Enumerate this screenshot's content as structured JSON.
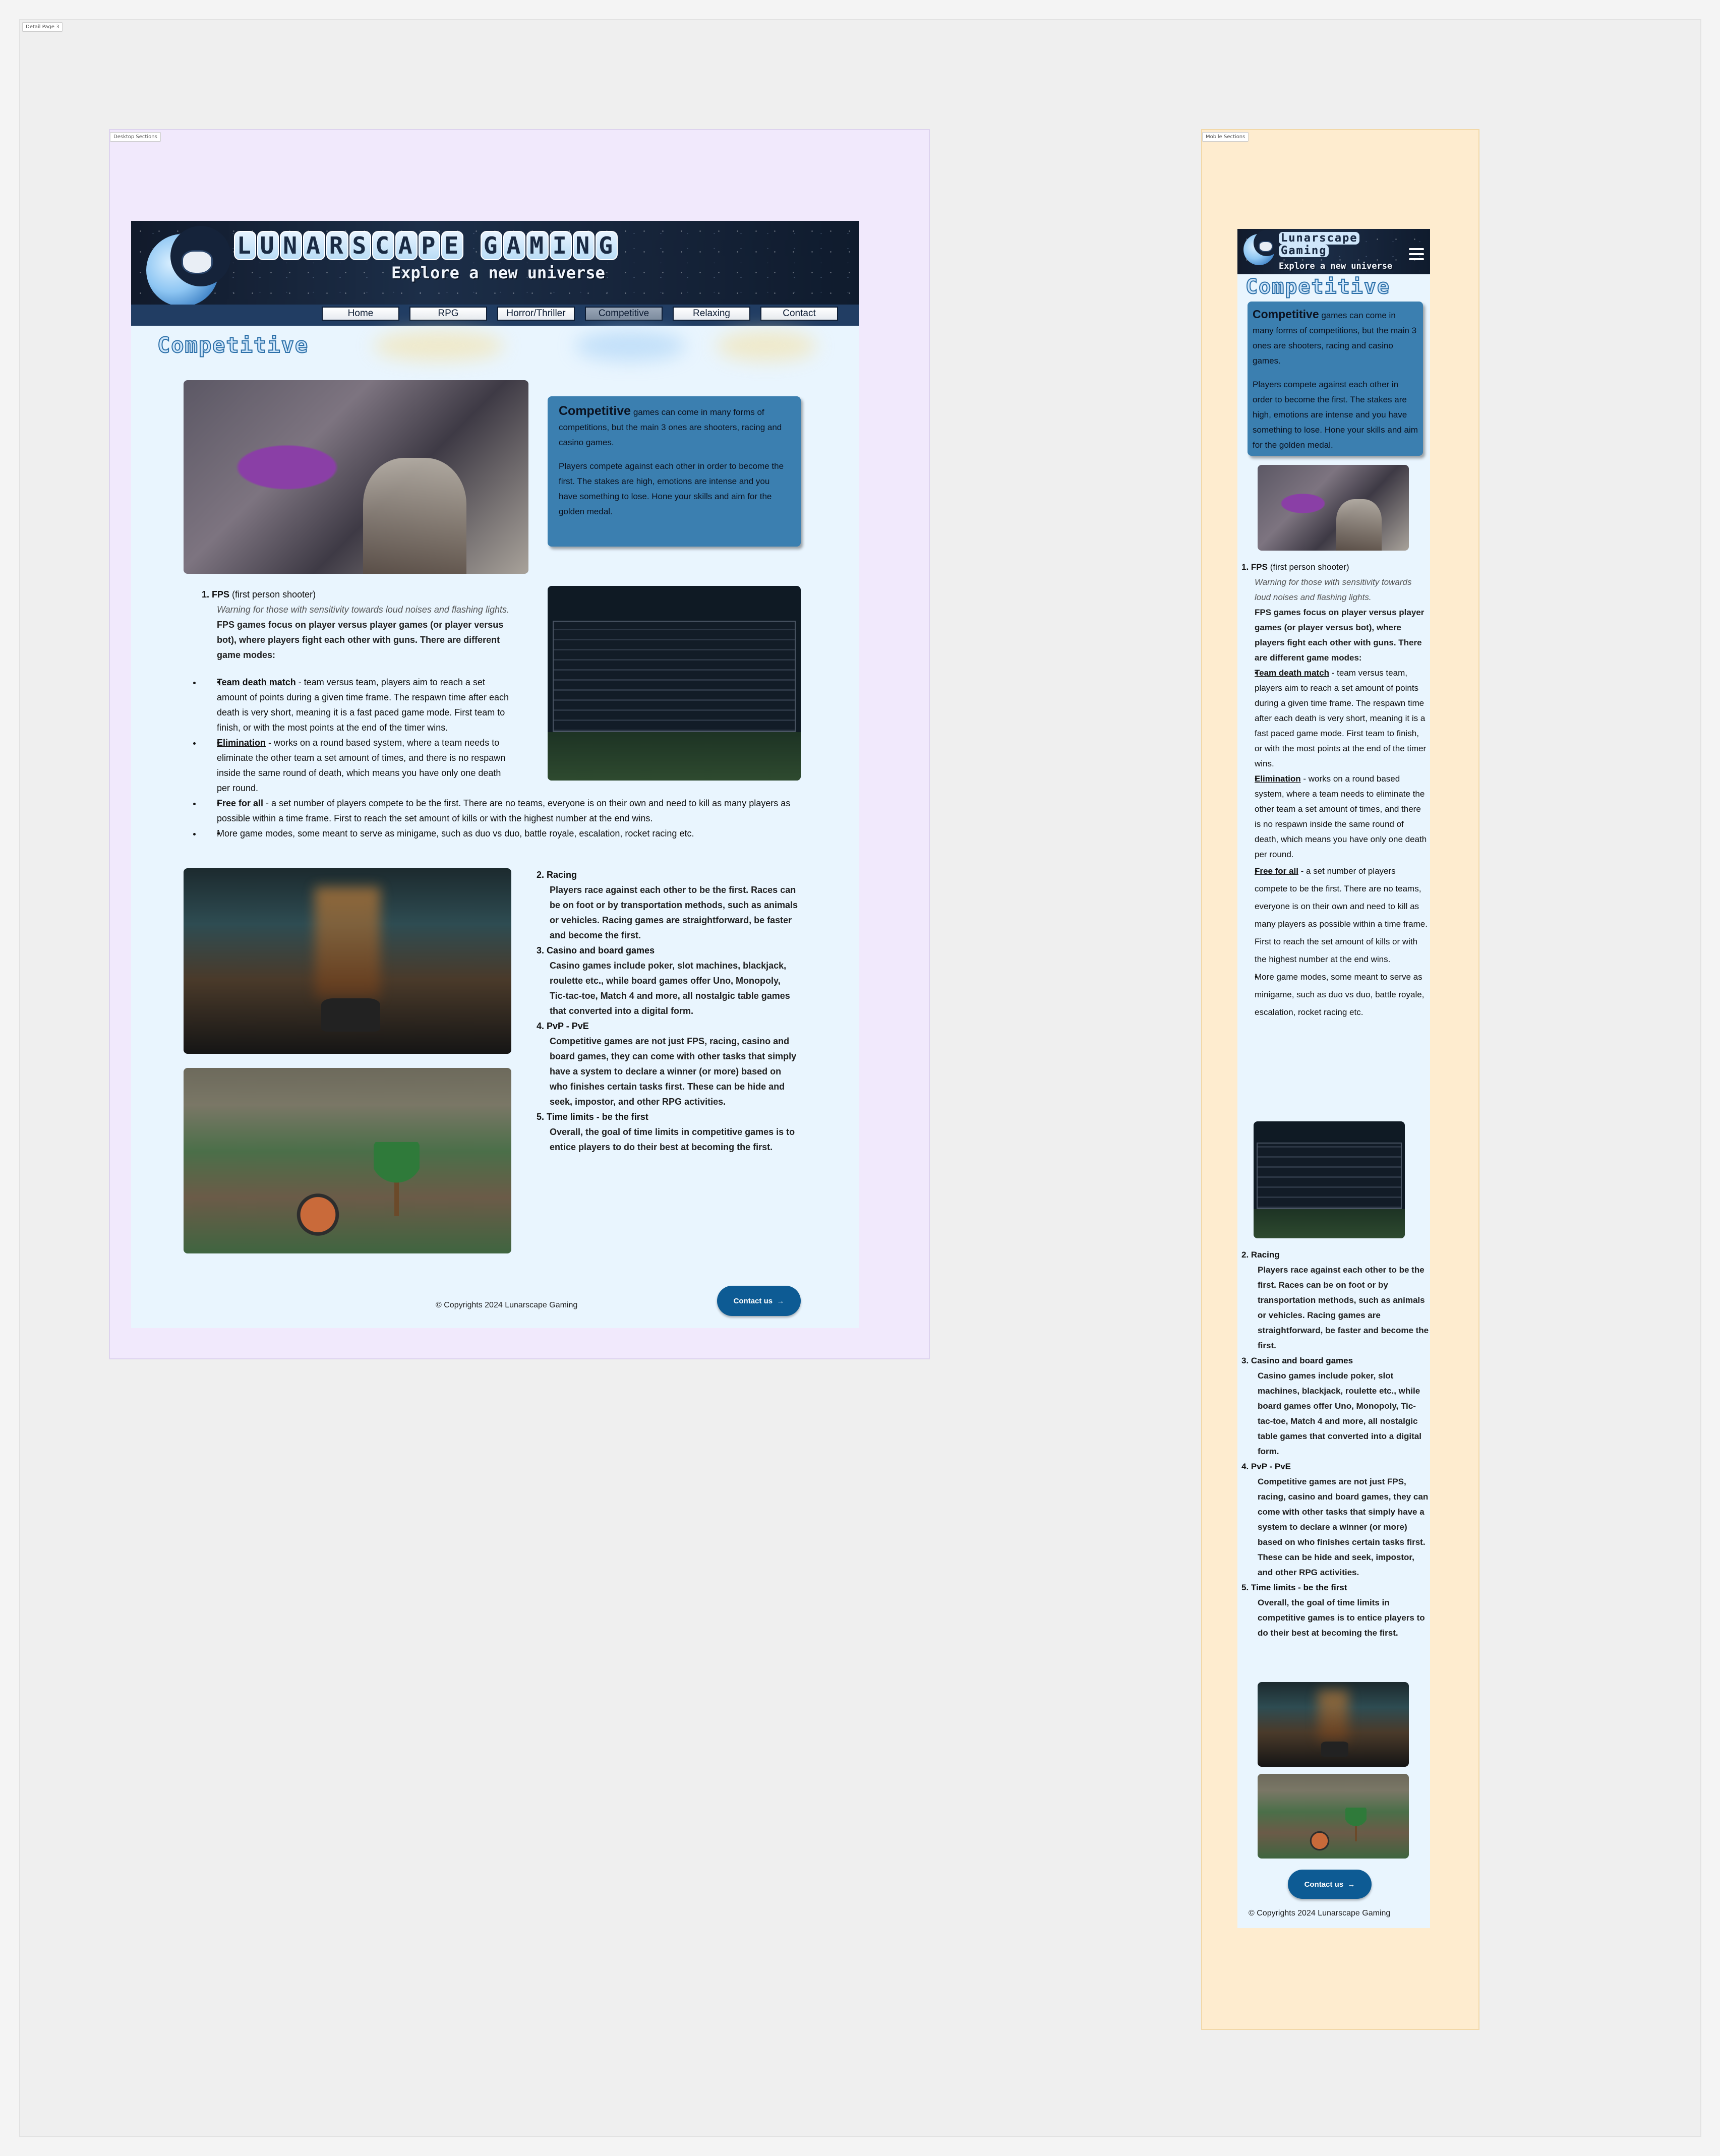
{
  "canvas": {
    "page_tag": "Detail Page 3"
  },
  "frames": {
    "desktop_tag": "Desktop Sections",
    "mobile_tag": "Mobile Sections"
  },
  "header": {
    "brand": [
      "L",
      "U",
      "N",
      "A",
      "R",
      "S",
      "C",
      "A",
      "P",
      "E",
      " ",
      "G",
      "A",
      "M",
      "I",
      "N",
      "G"
    ],
    "brand_text": "LUNARSCAPE GAMING",
    "brand_line1": "Lunarscape",
    "brand_line2": "Gaming",
    "tagline": "Explore a new universe",
    "nav": [
      "Home",
      "RPG",
      "Horror/Thriller",
      "Competitive",
      "Relaxing",
      "Contact"
    ],
    "active_nav": "Competitive"
  },
  "page": {
    "title": "Competitive"
  },
  "intro": {
    "lead": "Competitive",
    "p1_rest": " games can come in many forms of competitions, but the main 3 ones are shooters, racing and casino games.",
    "p2": "Players compete against each other in order to become the first. The stakes are high, emotions are intense and you have something to lose. Hone your skills and aim for the golden medal."
  },
  "fps": {
    "num": "1.",
    "title": "FPS",
    "title_suffix": " (first person shooter)",
    "warning": "Warning for those with sensitivity towards loud noises and flashing lights.",
    "desc": "FPS games focus on player versus player games (or player versus bot), where players fight each other with guns. There are different game modes:",
    "modes": [
      {
        "name": "Team death match",
        "text": " - team versus team, players aim to reach a set amount of points during a given time frame. The respawn time after each death is very short, meaning it is a fast paced game mode. First team to finish, or with the most points at the end of the timer wins."
      },
      {
        "name": "Elimination",
        "text": " - works on a round based system, where a team needs to eliminate the other team a set amount of times, and there is no respawn inside the same round of death, which means you have only one death per round."
      },
      {
        "name": "Free for all",
        "text": " - a set number of players compete to be the first. There are no teams, everyone is on their own and need to kill as many players as possible within a time frame. First to reach the set amount of kills or with the highest number at the end wins."
      },
      {
        "name": "",
        "text": "More game modes, some meant to serve as minigame, such as duo vs duo, battle royale, escalation, rocket racing etc."
      }
    ]
  },
  "sections": [
    {
      "num": "2.",
      "title": "Racing",
      "text": "Players race against each other to be the first. Races can be on foot or by transportation methods, such as animals or vehicles. Racing games are straightforward, be faster and become the first."
    },
    {
      "num": "3.",
      "title": "Casino and board games",
      "text": "Casino games include poker, slot machines, blackjack, roulette etc., while board games offer Uno, Monopoly, Tic-tac-toe, Match 4 and more, all nostalgic table games that converted into a digital form."
    },
    {
      "num": "4.",
      "title": "PvP - PvE",
      "text": "Competitive games are not just FPS, racing, casino and board games, they can come with other tasks that simply have a system to declare a winner (or more) based on who finishes certain tasks first. These can be hide and seek, impostor, and other RPG activities."
    },
    {
      "num": "5.",
      "title": "Time limits - be the first",
      "text": "Overall, the goal of time limits in competitive games is to entice players to do their best at becoming the first."
    }
  ],
  "footer": {
    "contact_label": "Contact us",
    "contact_arrow": "→",
    "copyright": "© Copyrights 2024 Lunarscape Gaming"
  },
  "images": {
    "fps": "shooter-screenshot",
    "lol": "scoreboard-screenshot",
    "racing": "city-racing-screenshot",
    "party": "party-game-screenshot"
  },
  "colors": {
    "info_box": "#3b7fb0",
    "contact_button": "#0d5b94",
    "desktop_frame": "#f1e9fc",
    "mobile_frame": "#feeccf",
    "site_bg": "#e9f5fe"
  }
}
